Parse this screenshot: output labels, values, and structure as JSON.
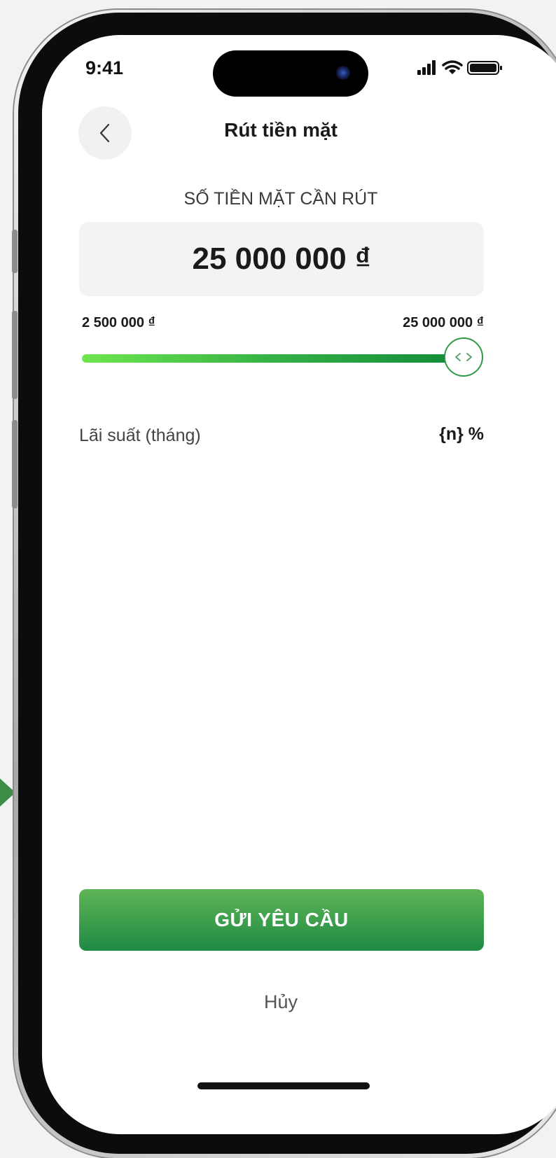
{
  "status_bar": {
    "time": "9:41"
  },
  "header": {
    "title": "Rút tiền mặt"
  },
  "amount": {
    "label": "SỐ TIỀN MẶT CẦN RÚT",
    "value": "25 000 000 ₫"
  },
  "slider": {
    "min_label": "2 500 000 ₫",
    "max_label": "25 000 000 ₫",
    "level": 1.0
  },
  "interest": {
    "label": "Lãi suất (tháng)",
    "value": "{n} %"
  },
  "actions": {
    "submit_label": "GỬI YÊU CẦU",
    "cancel_label": "Hủy"
  },
  "colors": {
    "accent": "#1f8a44",
    "slider_start": "#6ee64d",
    "slider_end": "#128a38"
  },
  "icons": {
    "back": "chevron-left-icon",
    "signal": "signal-icon",
    "wifi": "wifi-icon",
    "battery": "battery-icon",
    "thumb": "code-arrows-icon"
  }
}
